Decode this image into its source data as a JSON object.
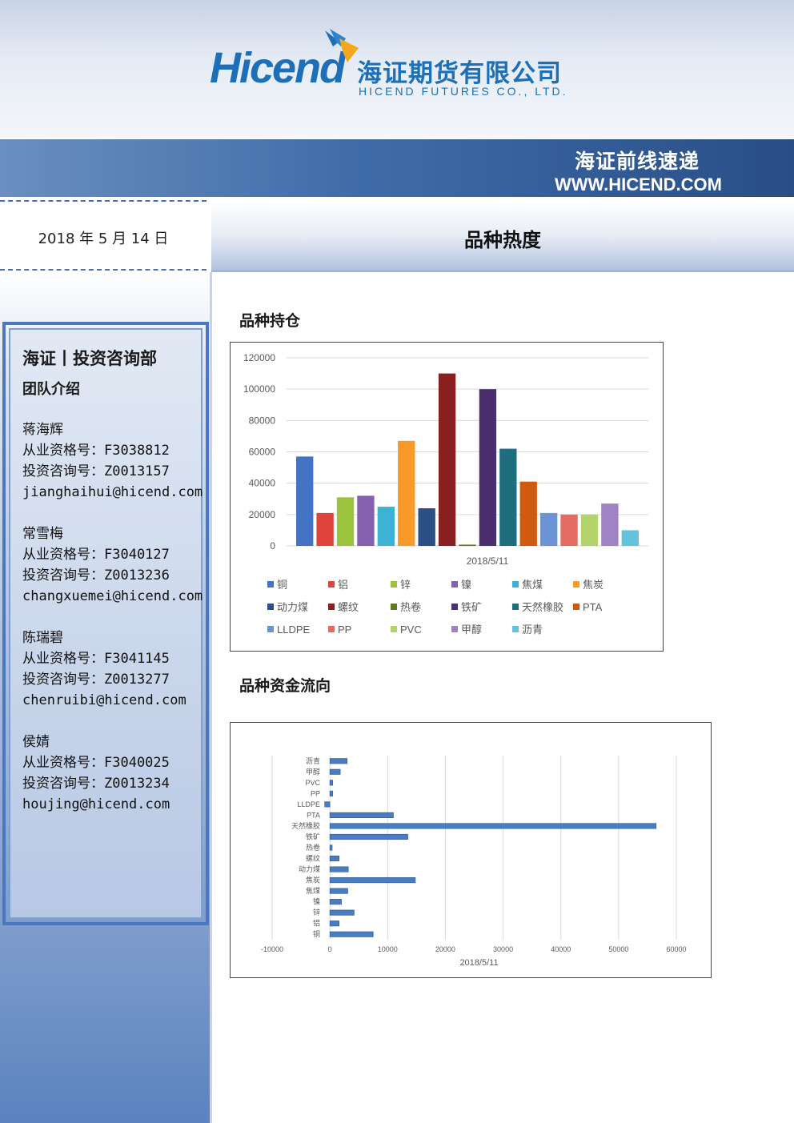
{
  "header": {
    "logo_brand": "Hicend",
    "logo_reg": "®",
    "logo_cn": "海证期货有限公司",
    "logo_en": "HICEND  FUTURES  CO.,  LTD.",
    "banner_cn": "海证前线速递",
    "banner_url": "WWW.HICEND.COM"
  },
  "report": {
    "date": "2018 年 5 月 14 日",
    "title": "品种热度"
  },
  "team": {
    "heading": "海证丨投资咨询部",
    "subheading": "团队介绍",
    "members": [
      {
        "name": "蒋海辉",
        "qualification": "从业资格号：F3038812",
        "consult": "投资咨询号：Z0013157",
        "email": "jianghaihui@hicend.com"
      },
      {
        "name": "常雪梅",
        "qualification": "从业资格号：F3040127",
        "consult": "投资咨询号：Z0013236",
        "email": "changxuemei@hicend.com"
      },
      {
        "name": "陈瑞碧",
        "qualification": "从业资格号：F3041145",
        "consult": "投资咨询号：Z0013277",
        "email": "chenruibi@hicend.com"
      },
      {
        "name": "侯婧",
        "qualification": "从业资格号：F3040025",
        "consult": "投资咨询号：Z0013234",
        "email": "houjing@hicend.com"
      }
    ]
  },
  "sections": {
    "open_interest_title": "品种持仓",
    "fund_flow_title": "品种资金流向"
  },
  "chart_data": [
    {
      "type": "bar",
      "title": "",
      "xlabel": "2018/5/11",
      "ylabel": "",
      "ylim": [
        0,
        120000
      ],
      "yticks": [
        "120000",
        "100000",
        "80000",
        "60000",
        "40000",
        "20000",
        "0"
      ],
      "grid": true,
      "legend_position": "bottom",
      "categories": [
        "2018/5/11"
      ],
      "series": [
        {
          "name": "铜",
          "values": [
            57000
          ],
          "color": "#4472c4"
        },
        {
          "name": "铝",
          "values": [
            21000
          ],
          "color": "#e0433c"
        },
        {
          "name": "锌",
          "values": [
            31000
          ],
          "color": "#9bc43c"
        },
        {
          "name": "镍",
          "values": [
            32000
          ],
          "color": "#8660b0"
        },
        {
          "name": "焦煤",
          "values": [
            25000
          ],
          "color": "#3cb3d4"
        },
        {
          "name": "焦炭",
          "values": [
            67000
          ],
          "color": "#f89a2a"
        },
        {
          "name": "动力煤",
          "values": [
            24000
          ],
          "color": "#2b4f86"
        },
        {
          "name": "螺纹",
          "values": [
            110000
          ],
          "color": "#8a1f1f"
        },
        {
          "name": "热卷",
          "values": [
            800
          ],
          "color": "#5b7a1e"
        },
        {
          "name": "铁矿",
          "values": [
            100000
          ],
          "color": "#4a2e6e"
        },
        {
          "name": "天然橡胶",
          "values": [
            62000
          ],
          "color": "#1e6e80"
        },
        {
          "name": "PTA",
          "values": [
            41000
          ],
          "color": "#d05a10"
        },
        {
          "name": "LLDPE",
          "values": [
            21000
          ],
          "color": "#6b93d6"
        },
        {
          "name": "PP",
          "values": [
            20000
          ],
          "color": "#e66b62"
        },
        {
          "name": "PVC",
          "values": [
            20000
          ],
          "color": "#b3d46a"
        },
        {
          "name": "甲醇",
          "values": [
            27000
          ],
          "color": "#a083c4"
        },
        {
          "name": "沥青",
          "values": [
            10000
          ],
          "color": "#63c2dc"
        }
      ]
    },
    {
      "type": "bar",
      "orientation": "horizontal",
      "title": "",
      "xlabel": "2018/5/11",
      "ylabel": "",
      "xlim": [
        -10000,
        60000
      ],
      "xticks": [
        "-10000",
        "0",
        "10000",
        "20000",
        "30000",
        "40000",
        "50000",
        "60000"
      ],
      "grid": true,
      "categories": [
        "沥青",
        "甲醇",
        "PVC",
        "PP",
        "LLDPE",
        "PTA",
        "天然橡胶",
        "铁矿",
        "热卷",
        "螺纹",
        "动力煤",
        "焦炭",
        "焦煤",
        "镍",
        "锌",
        "铝",
        "铜"
      ],
      "values": [
        3000,
        1800,
        500,
        500,
        -900,
        11000,
        56500,
        13500,
        400,
        1600,
        3200,
        14800,
        3100,
        2000,
        4200,
        1600,
        7500
      ],
      "color": "#4a7cc0"
    }
  ]
}
